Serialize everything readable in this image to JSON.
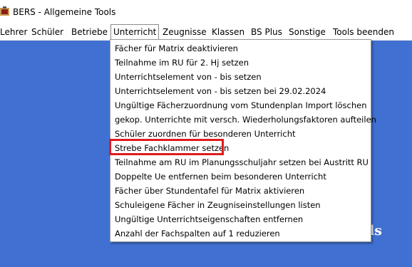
{
  "window": {
    "title": "BERS - Allgemeine Tools",
    "icon": "bers-app-icon"
  },
  "menubar": {
    "items": [
      {
        "label": "Lehrer"
      },
      {
        "label": "Schüler"
      },
      {
        "label": "Betriebe"
      },
      {
        "label": "Unterricht",
        "active": true
      },
      {
        "label": "Zeugnisse"
      },
      {
        "label": "Klassen"
      },
      {
        "label": "BS Plus"
      },
      {
        "label": "Sonstige"
      },
      {
        "label": "Tools beenden"
      }
    ]
  },
  "dropdown": {
    "items": [
      {
        "label": "Fächer für Matrix deaktivieren"
      },
      {
        "label": "Teilnahme im RU für 2. Hj setzen"
      },
      {
        "label": "Unterrichtselement von - bis setzen"
      },
      {
        "label": "Unterrichtselement von - bis setzen bei 29.02.2024"
      },
      {
        "label": "Ungültige Fächerzuordnung vom Stundenplan Import löschen"
      },
      {
        "label": "gekop. Unterrichte mit versch. Wiederholungsfaktoren aufteilen"
      },
      {
        "label": "Schüler zuordnen für besonderen Unterricht"
      },
      {
        "label": "Strebe Fachklammer setzen",
        "highlighted": true
      },
      {
        "label": "Teilnahme am RU im Planungsschuljahr setzen bei Austritt RU"
      },
      {
        "label": "Doppelte Ue entfernen beim besonderen Unterricht"
      },
      {
        "label": "Fächer über Stundentafel für Matrix aktivieren"
      },
      {
        "label": "Schuleigene Fächer in Zeugniseinstellungen listen"
      },
      {
        "label": "Ungültige Unterrichtseigenschaften entfernen"
      },
      {
        "label": "Anzahl der Fachspalten auf 1 reduzieren"
      }
    ]
  },
  "background": {
    "partial_text": "ls"
  },
  "colors": {
    "workspace": "#4170d3",
    "highlight": "#e01b1b"
  }
}
